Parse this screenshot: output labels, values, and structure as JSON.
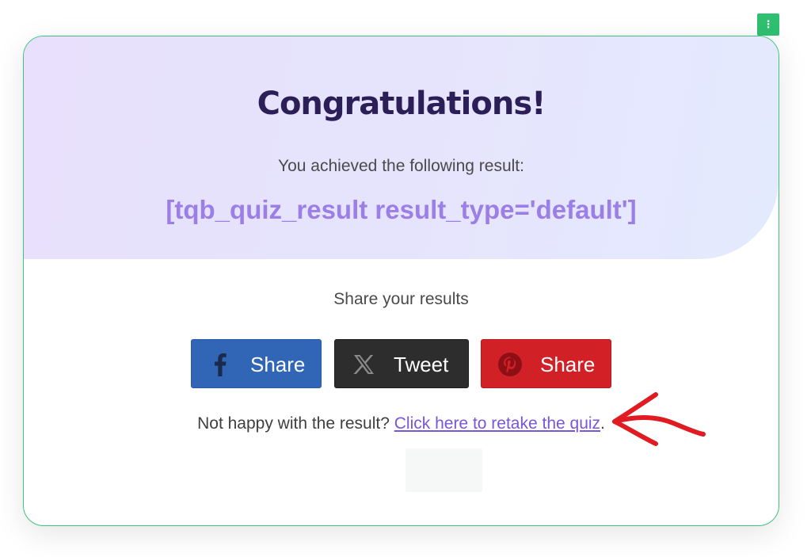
{
  "menu_handle": {
    "icon": "vertical-dots-icon",
    "glyph": "⋮",
    "color": "#2fbf71"
  },
  "hero": {
    "title": "Congratulations!",
    "subtitle": "You achieved the following result:",
    "shortcode": "[tqb_quiz_result result_type='default']"
  },
  "share": {
    "label": "Share your results",
    "buttons": [
      {
        "network": "facebook",
        "icon": "facebook-icon",
        "label": "Share",
        "color": "#3066b5"
      },
      {
        "network": "x",
        "icon": "x-logo-icon",
        "label": "Tweet",
        "color": "#2d2d2d"
      },
      {
        "network": "pinterest",
        "icon": "pinterest-icon",
        "label": "Share",
        "color": "#d22027"
      }
    ]
  },
  "retake": {
    "prefix": "Not happy with the result?",
    "link_text": "Click here to retake the quiz",
    "suffix": "."
  },
  "colors": {
    "accent_border": "#3cc47c",
    "title": "#2c1f58",
    "shortcode": "#9b7fe6",
    "link": "#7a55d6",
    "annotation_arrow": "#e01b22"
  }
}
